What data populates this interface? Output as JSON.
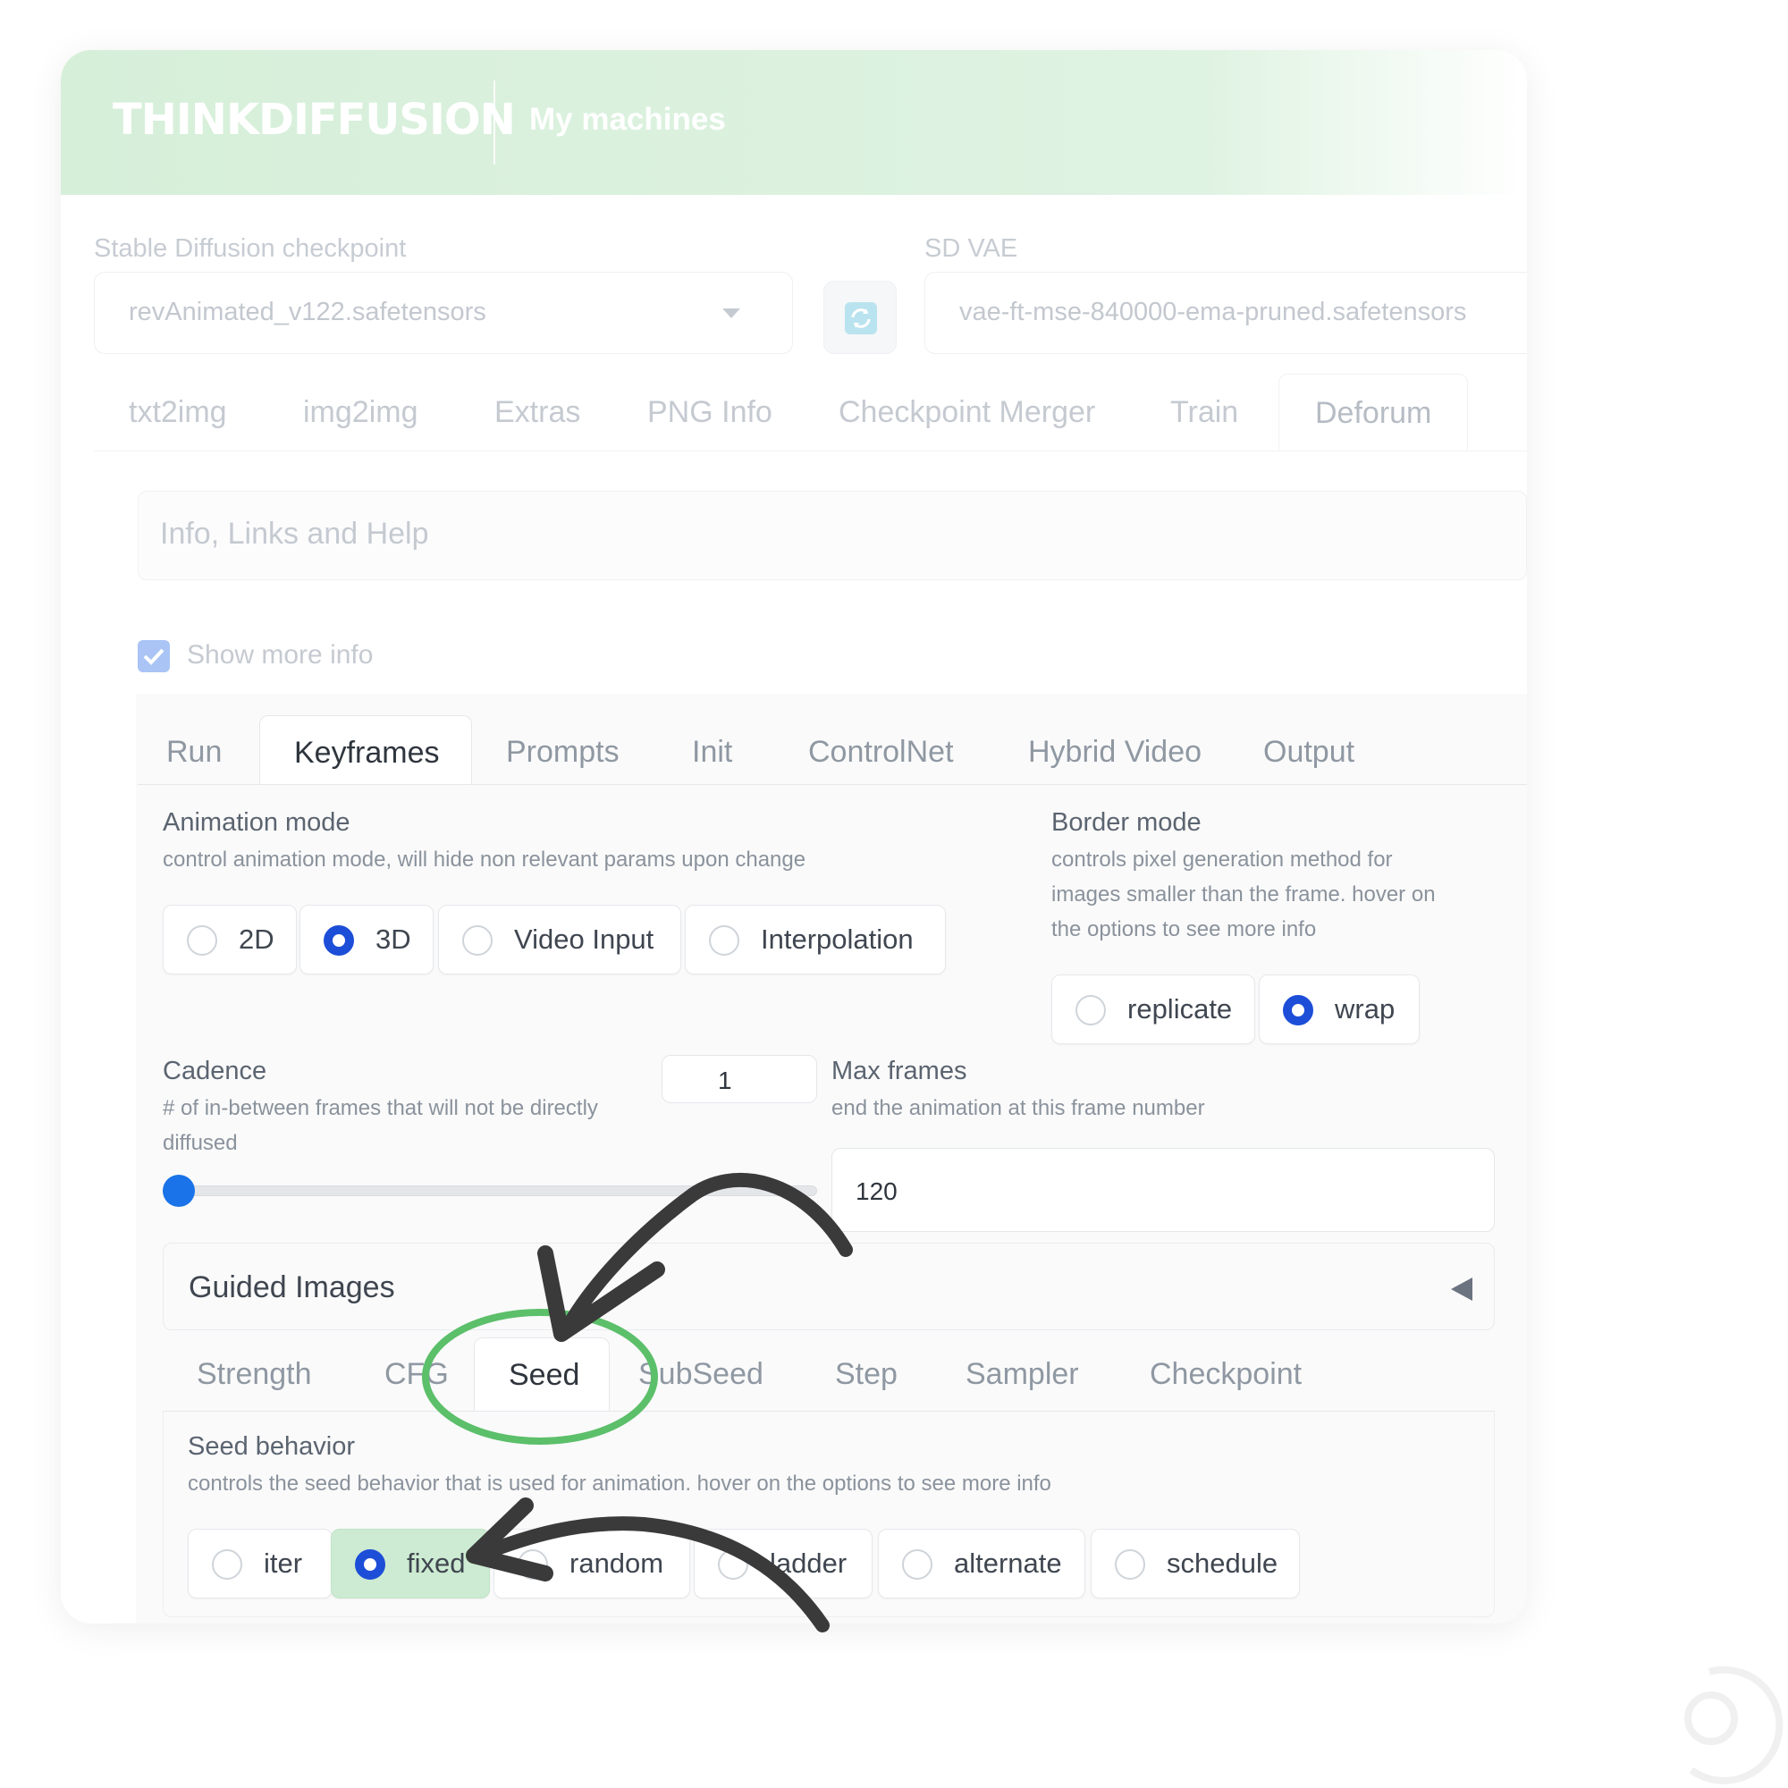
{
  "header": {
    "brand": "THINKDIFFUSION",
    "nav": "My machines"
  },
  "checkpoint": {
    "label": "Stable Diffusion checkpoint",
    "value": "revAnimated_v122.safetensors"
  },
  "vae": {
    "label": "SD VAE",
    "value": "vae-ft-mse-840000-ema-pruned.safetensors"
  },
  "main_tabs": [
    "txt2img",
    "img2img",
    "Extras",
    "PNG Info",
    "Checkpoint Merger",
    "Train",
    "Deforum"
  ],
  "info": {
    "title": "Info, Links and Help"
  },
  "show_more": {
    "label": "Show more info",
    "checked": true
  },
  "deforum_tabs": [
    "Run",
    "Keyframes",
    "Prompts",
    "Init",
    "ControlNet",
    "Hybrid Video",
    "Output"
  ],
  "deforum_active": "Keyframes",
  "animation_mode": {
    "label": "Animation mode",
    "hint": "control animation mode, will hide non relevant params upon change",
    "options": [
      "2D",
      "3D",
      "Video Input",
      "Interpolation"
    ],
    "selected": "3D"
  },
  "border_mode": {
    "label": "Border mode",
    "hint_lines": [
      "controls pixel generation method for",
      "images smaller than the frame. hover on",
      "the options to see more info"
    ],
    "options": [
      "replicate",
      "wrap"
    ],
    "selected": "wrap"
  },
  "cadence": {
    "label": "Cadence",
    "hint_lines": [
      "# of in-between frames that will not be directly",
      "diffused"
    ],
    "value": "1",
    "slider_fraction": 0.0
  },
  "max_frames": {
    "label": "Max frames",
    "hint": "end the animation at this frame number",
    "value": "120"
  },
  "guided_images": {
    "label": "Guided Images"
  },
  "schedule_tabs": [
    "Strength",
    "CFG",
    "Seed",
    "SubSeed",
    "Step",
    "Sampler",
    "Checkpoint"
  ],
  "schedule_active": "Seed",
  "seed_behavior": {
    "label": "Seed behavior",
    "hint": "controls the seed behavior that is used for animation. hover on the options to see more info",
    "options": [
      "iter",
      "fixed",
      "random",
      "ladder",
      "alternate",
      "schedule"
    ],
    "selected": "fixed"
  },
  "colors": {
    "header_bg": "#d6efd9",
    "radio_checked": "#1d4ed8",
    "highlight_green": "#5cbf6a",
    "arrow": "#3a3a3a"
  }
}
